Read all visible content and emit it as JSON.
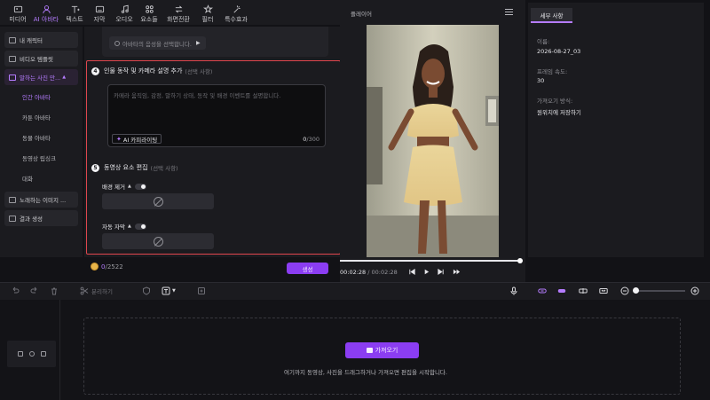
{
  "toolbar": {
    "items": [
      {
        "label": "미디어",
        "icon": "media-icon"
      },
      {
        "label": "AI 아바타",
        "icon": "avatar-icon",
        "active": true
      },
      {
        "label": "텍스트",
        "icon": "text-icon"
      },
      {
        "label": "자막",
        "icon": "subtitle-icon"
      },
      {
        "label": "오디오",
        "icon": "audio-icon"
      },
      {
        "label": "요소들",
        "icon": "elements-icon"
      },
      {
        "label": "화면전환",
        "icon": "transition-icon"
      },
      {
        "label": "필터",
        "icon": "filter-icon"
      },
      {
        "label": "특수효과",
        "icon": "effects-icon"
      }
    ]
  },
  "sidebar": {
    "items": [
      {
        "label": "내 캐릭터"
      },
      {
        "label": "비디오 템플릿"
      },
      {
        "label": "말하는 사진 만..."
      }
    ],
    "sub_items": [
      "인간 아바타",
      "카툰 아바타",
      "동물 아바타",
      "동영상 립싱크",
      "대화"
    ],
    "bottom_items": [
      {
        "label": "노래하는 이미지 ..."
      },
      {
        "label": "결과 생성"
      }
    ]
  },
  "config": {
    "avatar_chip": "아바타의 음성을 선택합니다.",
    "step4": {
      "num": "4",
      "title": "인물 동작 및 카메라 설명 추가",
      "optional": "(선택 사항)"
    },
    "prompt_placeholder": "카메라 움직임, 감정, 말하기 상태, 동작 및 배경 이벤트를 설명합니다.",
    "copilot_label": "AI 카피라이팅",
    "counter_used": "0",
    "counter_max": "/300",
    "step5": {
      "num": "5",
      "title": "동영상 요소 편집",
      "optional": "(선택 사항)"
    },
    "bg_remove_label": "배경 제거",
    "auto_caption_label": "자동 자막",
    "credits_used": "0",
    "credits_total": "/2522",
    "generate_label": "생성"
  },
  "player": {
    "title": "플레이어",
    "time_current": "00:02:28",
    "time_sep": " / ",
    "time_total": "00:02:28",
    "progress": 1.0
  },
  "details": {
    "tab": "세부 사항",
    "name_label": "이름:",
    "name_value": "2026-08-27_03",
    "fps_label": "프레임 속도:",
    "fps_value": "30",
    "import_label": "가져오기 방식:",
    "import_value": "원위치에 저장하기"
  },
  "timeline": {
    "split_label": "분리하기",
    "import_button": "가져오기",
    "hint": "여기까지 동영상, 사진을 드래그하거나 가져오면 편집을 시작합니다."
  },
  "colors": {
    "accent": "#8b3df2",
    "accent_text": "#b57cff",
    "highlight_border": "#e0464e",
    "panel": "#1b1b1f",
    "background": "#121216"
  }
}
